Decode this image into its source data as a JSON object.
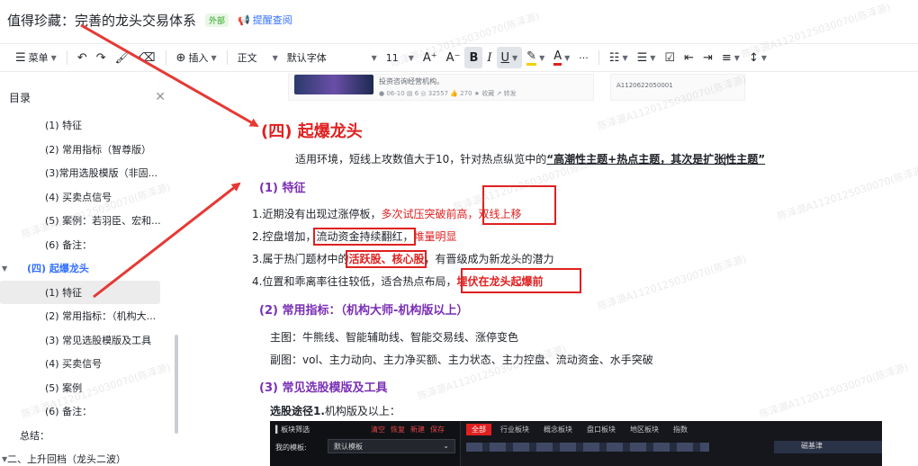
{
  "header": {
    "title": "值得珍藏：完善的龙头交易体系",
    "external_tag": "外部",
    "remind_label": "提醒查阅"
  },
  "toolbar": {
    "menu_label": "菜单",
    "insert_label": "插入",
    "paragraph_style": "正文",
    "font_name": "默认字体",
    "font_size": "11",
    "more_label": "···"
  },
  "sidebar": {
    "title": "目录",
    "items": [
      {
        "label": "(1) 特征"
      },
      {
        "label": "(2) 常用指标（智尊版）"
      },
      {
        "label": "(3)常用选股模版（非固..."
      },
      {
        "label": "(4) 买卖点信号"
      },
      {
        "label": "(5) 案例：若羽臣、宏和..."
      },
      {
        "label": "(6) 备注："
      },
      {
        "label": "(四) 起爆龙头"
      },
      {
        "label": "(1) 特征"
      },
      {
        "label": "(2) 常用指标：（机构大..."
      },
      {
        "label": "(3) 常见选股模版及工具"
      },
      {
        "label": "(4) 买卖信号"
      },
      {
        "label": "(5) 案例"
      },
      {
        "label": "(6) 备注："
      },
      {
        "label": "总结："
      },
      {
        "label": "二、上升回档（龙头二波）"
      }
    ]
  },
  "preview": {
    "card_text": "投资咨询经营机构。",
    "card_meta": "● 06-10  ▤ 6  ◎ 32557  👍 270  ★ 收藏  ↗ 转发",
    "card_id": "A1120622050001"
  },
  "content": {
    "section_title": "(四) 起爆龙头",
    "intro_prefix": "适用环境，短线上攻数值大于10，针对热点纵览中的",
    "intro_highlight_a": "“高潮性主题+热点主题，其次是扩张",
    "intro_highlight_b": "性主题”",
    "feature_heading": "(1) 特征",
    "f1_a": "1.近期没有出现过涨停板，",
    "f1_red_a": "多次试压突破前高，",
    "f1_red_b": "双线上移",
    "f2_a": "2.控盘增加，",
    "f2_box": "流动资金持续翻红，",
    "f2_red": "堆量明显",
    "f3_a": "3.属于热门题材中的",
    "f3_box": "活跃股、核心股",
    "f3_b": "，有晋级成为新龙头的潜力",
    "f4_a": "4.位置和乖离率往往较低，适合热点布局，",
    "f4_box": "埋伏在龙头起爆前",
    "indicator_heading": "(2) 常用指标：（机构大师-机构版以上）",
    "main_chart": "主图：牛熊线、智能辅助线、智能交易线、涨停变色",
    "sub_chart": "副图：vol、主力动向、主力净买额、主力状态、主力控盘、流动资金、水手突破",
    "tools_heading": "(3) 常见选股模版及工具",
    "path_bold": "选股途径1.",
    "path_rest": "机构版及以上："
  },
  "embed": {
    "panel_title": "▍板块筛选",
    "actions": [
      "清空",
      "恢复",
      "新建",
      "保存"
    ],
    "template_label": "我的模板:",
    "template_value": "默认模板",
    "tabs": [
      "全部",
      "行业板块",
      "概念板块",
      "盘口板块",
      "地区板块",
      "指数"
    ],
    "right_label": "磁基津"
  },
  "watermark": "陈泽源A1120125030070(陈泽源)",
  "colors": {
    "accent_red": "#e02020",
    "heading_purple": "#7a2fb5",
    "link_blue": "#3370ff"
  }
}
